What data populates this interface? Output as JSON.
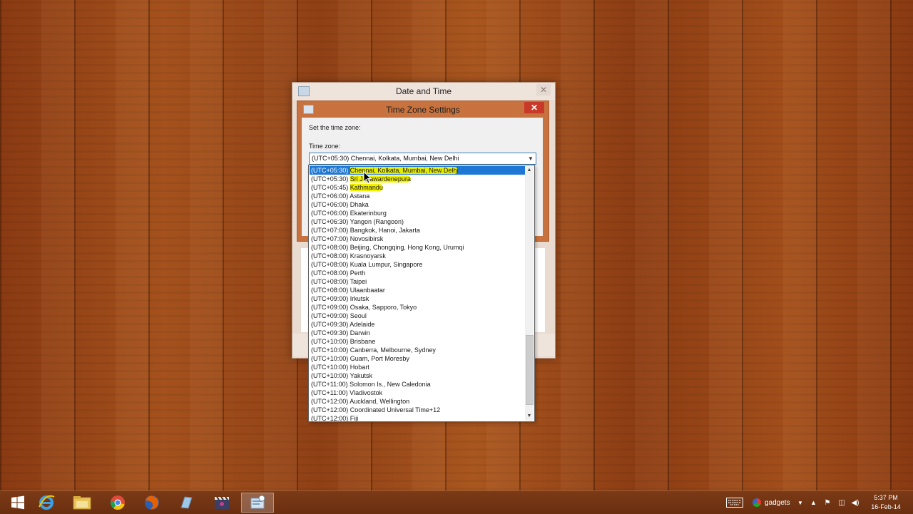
{
  "date_time_window": {
    "title": "Date and Time",
    "close_symbol": "✕"
  },
  "tz_dialog": {
    "title": "Time Zone Settings",
    "close_symbol": "✕",
    "set_label": "Set the time zone:",
    "tz_label": "Time zone:",
    "selected_value": "(UTC+05:30) Chennai, Kolkata, Mumbai, New Delhi"
  },
  "dropdown": {
    "items": [
      {
        "offset": "(UTC+05:30)",
        "city": "Chennai, Kolkata, Mumbai, New Delhi",
        "selected": true
      },
      {
        "offset": "(UTC+05:30)",
        "city": "Sri Jayawardenepura"
      },
      {
        "offset": "(UTC+05:45)",
        "city": "Kathmandu"
      },
      {
        "offset": "(UTC+06:00)",
        "city": "Astana"
      },
      {
        "offset": "(UTC+06:00)",
        "city": "Dhaka"
      },
      {
        "offset": "(UTC+06:00)",
        "city": "Ekaterinburg"
      },
      {
        "offset": "(UTC+06:30)",
        "city": "Yangon (Rangoon)"
      },
      {
        "offset": "(UTC+07:00)",
        "city": "Bangkok, Hanoi, Jakarta"
      },
      {
        "offset": "(UTC+07:00)",
        "city": "Novosibirsk"
      },
      {
        "offset": "(UTC+08:00)",
        "city": "Beijing, Chongqing, Hong Kong, Urumqi"
      },
      {
        "offset": "(UTC+08:00)",
        "city": "Krasnoyarsk"
      },
      {
        "offset": "(UTC+08:00)",
        "city": "Kuala Lumpur, Singapore"
      },
      {
        "offset": "(UTC+08:00)",
        "city": "Perth"
      },
      {
        "offset": "(UTC+08:00)",
        "city": "Taipei"
      },
      {
        "offset": "(UTC+08:00)",
        "city": "Ulaanbaatar"
      },
      {
        "offset": "(UTC+09:00)",
        "city": "Irkutsk"
      },
      {
        "offset": "(UTC+09:00)",
        "city": "Osaka, Sapporo, Tokyo"
      },
      {
        "offset": "(UTC+09:00)",
        "city": "Seoul"
      },
      {
        "offset": "(UTC+09:30)",
        "city": "Adelaide"
      },
      {
        "offset": "(UTC+09:30)",
        "city": "Darwin"
      },
      {
        "offset": "(UTC+10:00)",
        "city": "Brisbane"
      },
      {
        "offset": "(UTC+10:00)",
        "city": "Canberra, Melbourne, Sydney"
      },
      {
        "offset": "(UTC+10:00)",
        "city": "Guam, Port Moresby"
      },
      {
        "offset": "(UTC+10:00)",
        "city": "Hobart"
      },
      {
        "offset": "(UTC+10:00)",
        "city": "Yakutsk"
      },
      {
        "offset": "(UTC+11:00)",
        "city": "Solomon Is., New Caledonia"
      },
      {
        "offset": "(UTC+11:00)",
        "city": "Vladivostok"
      },
      {
        "offset": "(UTC+12:00)",
        "city": "Auckland, Wellington"
      },
      {
        "offset": "(UTC+12:00)",
        "city": "Coordinated Universal Time+12"
      },
      {
        "offset": "(UTC+12:00)",
        "city": "Fiji"
      }
    ],
    "highlight_color": "#f3f100",
    "selection_color": "#1e77d4"
  },
  "taskbar": {
    "apps": [
      "windows-start",
      "internet-explorer",
      "file-explorer",
      "chrome",
      "firefox",
      "app",
      "movie-maker",
      "date-time-settings"
    ],
    "tray": {
      "toolbar_label": "gadgets",
      "time": "5:37 PM",
      "date": "16-Feb-14"
    }
  },
  "colors": {
    "titlebar_active": "#c8733f",
    "close_button": "#c9392a",
    "taskbar": "#6a2f10"
  }
}
